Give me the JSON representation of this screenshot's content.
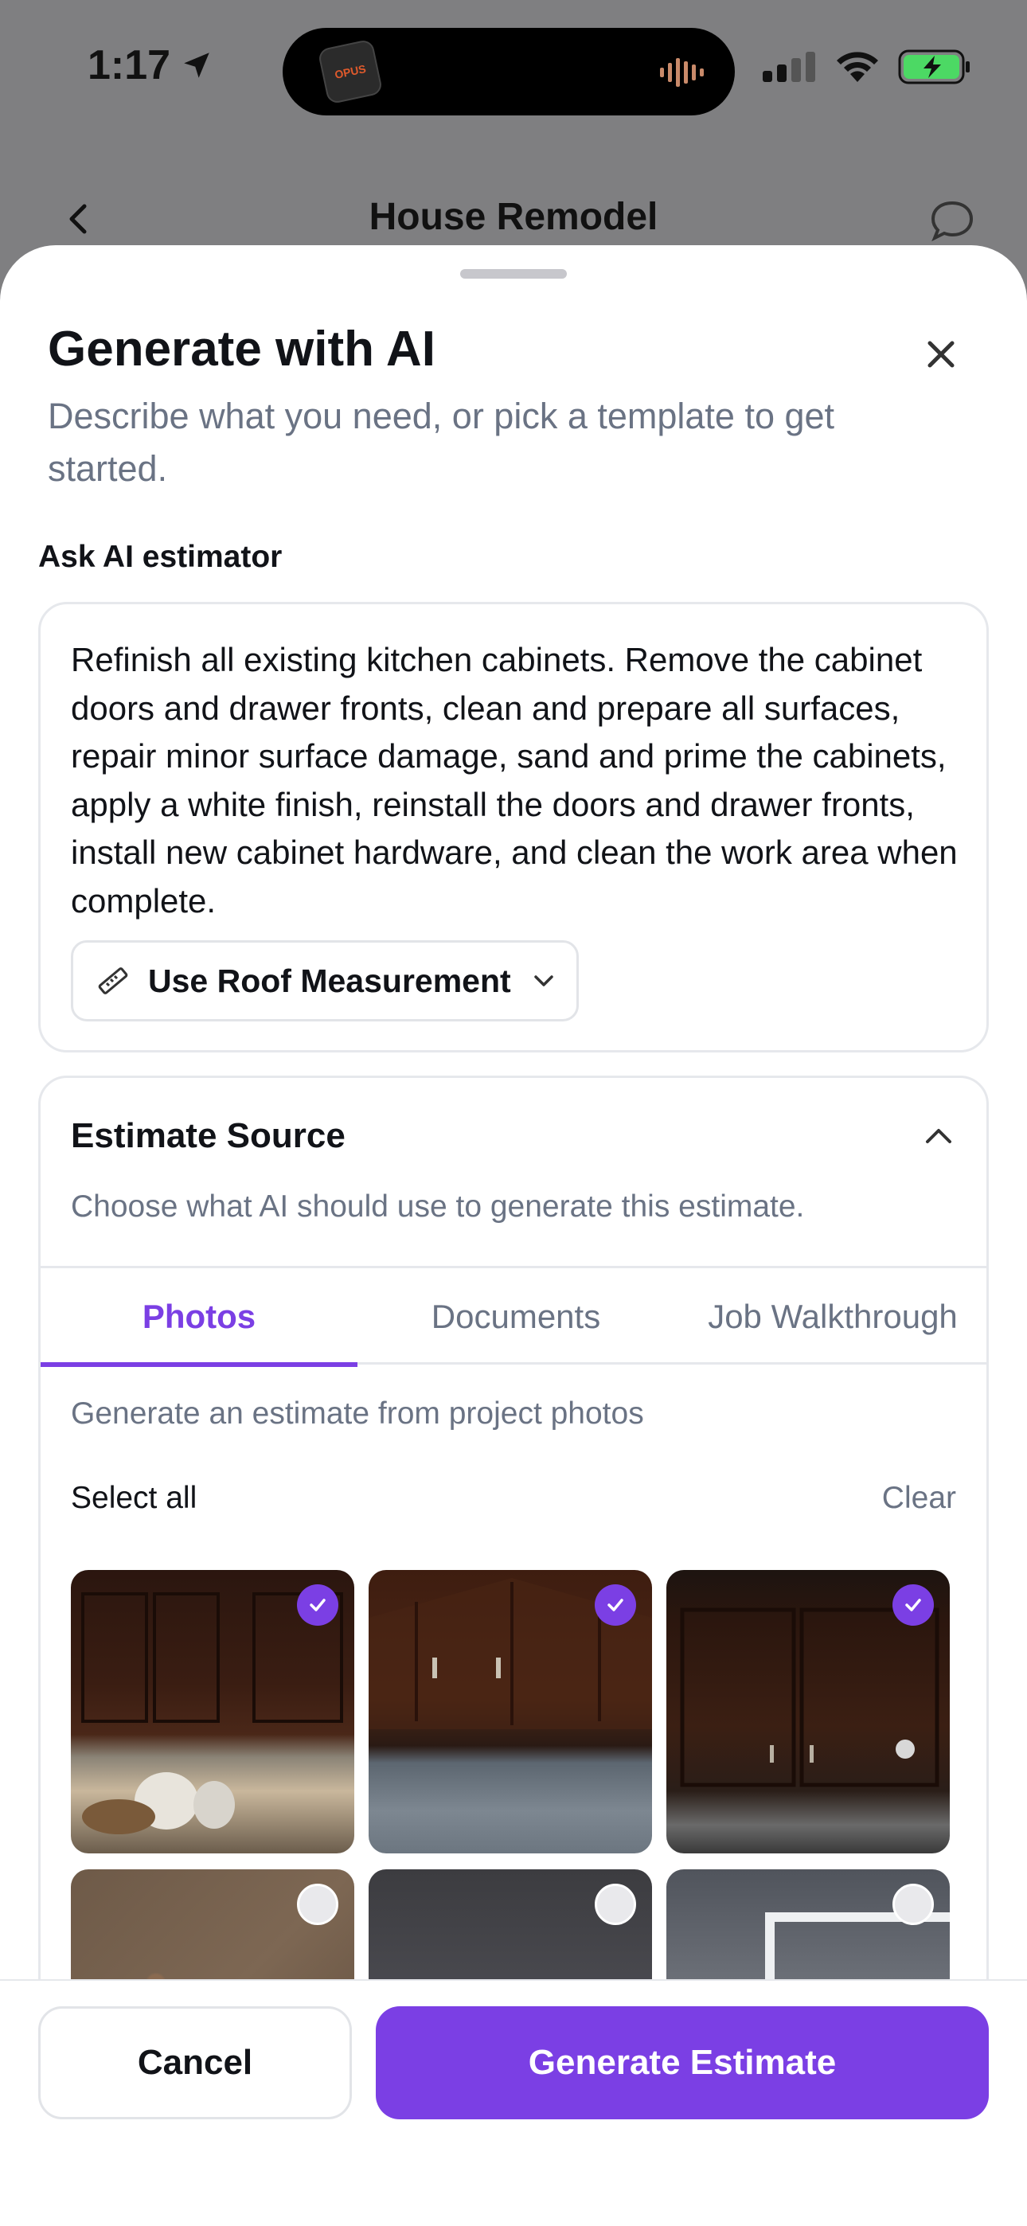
{
  "status_bar": {
    "time": "1:17",
    "island_app": "OPUS",
    "icons": [
      "location-icon",
      "signal-icon",
      "wifi-icon",
      "battery-charging-icon"
    ]
  },
  "background_page": {
    "title": "House Remodel"
  },
  "sheet": {
    "title": "Generate with AI",
    "subtitle": "Describe what you need, or pick a template to get started.",
    "ask_label": "Ask AI estimator",
    "prompt_text": "Refinish all existing kitchen cabinets. Remove the cabinet doors and drawer fronts, clean and prepare all surfaces, repair minor surface damage, sand and prime the cabinets, apply a white finish, reinstall the doors and drawer fronts, install new cabinet hardware, and clean the work area when complete.",
    "measurement_button": "Use Roof Measurement"
  },
  "estimate_source": {
    "title": "Estimate Source",
    "description": "Choose what AI should use to generate this estimate.",
    "tabs": [
      {
        "label": "Photos",
        "active": true
      },
      {
        "label": "Documents",
        "active": false
      },
      {
        "label": "Job Walkthrough",
        "active": false
      }
    ],
    "photos_description": "Generate an estimate from project photos",
    "select_all": "Select all",
    "clear": "Clear",
    "photos": [
      {
        "subject": "kitchen cabinets with counter items",
        "selected": true
      },
      {
        "subject": "underside of cabinet",
        "selected": true
      },
      {
        "subject": "dark wood cabinet doors",
        "selected": true
      },
      {
        "subject": "granite countertop",
        "selected": false
      },
      {
        "subject": "ceiling corner",
        "selected": false
      },
      {
        "subject": "window with trees",
        "selected": false
      }
    ]
  },
  "footer": {
    "cancel": "Cancel",
    "generate": "Generate Estimate"
  },
  "colors": {
    "accent": "#7b3fe4",
    "muted_text": "#6a7384",
    "border": "#e6e8ec",
    "overlay": "#7f7f81"
  }
}
